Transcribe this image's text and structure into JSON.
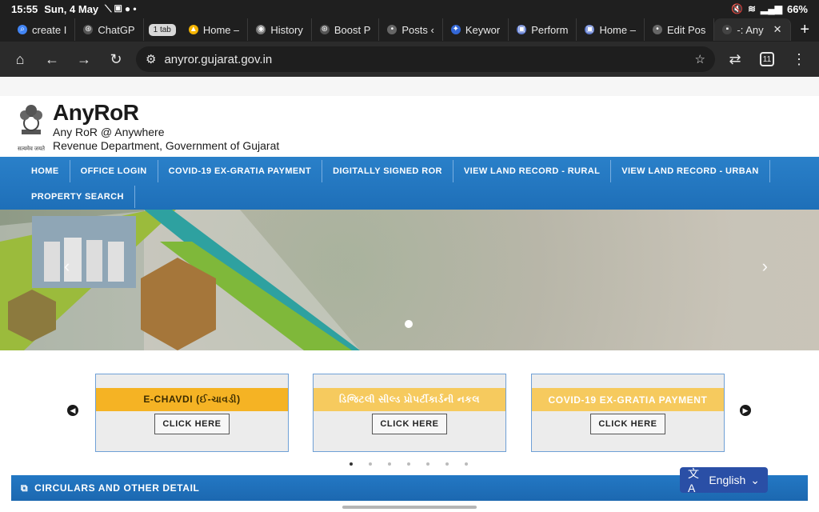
{
  "status": {
    "time": "15:55",
    "date": "Sun, 4 May",
    "battery": "66%"
  },
  "tabs": [
    {
      "label": "create I",
      "color": "#4285f4",
      "glyph": "⌕"
    },
    {
      "label": "ChatGP",
      "color": "#555555",
      "glyph": "⊛"
    },
    {
      "label": "1 tab",
      "type": "count"
    },
    {
      "label": "Home –",
      "color": "#f4b400",
      "glyph": "▲"
    },
    {
      "label": "History",
      "color": "#777777",
      "glyph": "◉"
    },
    {
      "label": "Boost P",
      "color": "#555555",
      "glyph": "⊛"
    },
    {
      "label": "Posts ‹",
      "color": "#666666",
      "glyph": "•"
    },
    {
      "label": "Keywor",
      "color": "#3367d6",
      "glyph": "✦"
    },
    {
      "label": "Perform",
      "color": "#5f7bd0",
      "glyph": "▣"
    },
    {
      "label": "Home –",
      "color": "#5f7bd0",
      "glyph": "▣"
    },
    {
      "label": "Edit Pos",
      "color": "#666666",
      "glyph": "•"
    },
    {
      "label": "-: Any",
      "color": "#444444",
      "glyph": "▪",
      "active": true
    }
  ],
  "toolbar": {
    "url": "anyror.gujarat.gov.in",
    "tab_count": "11"
  },
  "site": {
    "emblem_caption": "सत्यमेव जयते",
    "title": "AnyRoR",
    "subtitle1": "Any RoR @ Anywhere",
    "subtitle2": "Revenue Department, Government of Gujarat"
  },
  "nav": {
    "row1": [
      "HOME",
      "OFFICE LOGIN",
      "COVID-19 EX-GRATIA PAYMENT",
      "DIGITALLY SIGNED ROR",
      "VIEW LAND RECORD - RURAL",
      "VIEW LAND RECORD - URBAN"
    ],
    "row2": [
      "PROPERTY SEARCH"
    ]
  },
  "cards": [
    {
      "title": "E-CHAVDI (ઈ-ચાવડી)",
      "button": "CLICK HERE"
    },
    {
      "title": "ડિજિટલી સીલ્ડ પ્રોપર્ટીકાર્ડની નકલ",
      "button": "CLICK HERE"
    },
    {
      "title": "COVID-19 EX-GRATIA PAYMENT",
      "button": "CLICK HERE"
    }
  ],
  "circulars": "CIRCULARS AND OTHER DETAIL",
  "language": "English"
}
